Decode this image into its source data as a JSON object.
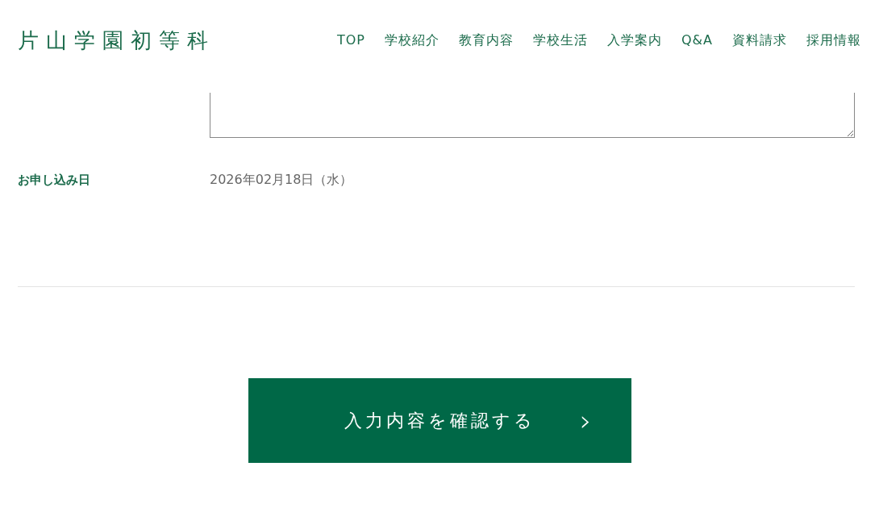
{
  "header": {
    "logo": "片山学園初等科",
    "nav": [
      "TOP",
      "学校紹介",
      "教育内容",
      "学校生活",
      "入学案内",
      "Q&A",
      "資料請求",
      "採用情報"
    ]
  },
  "form": {
    "rows": [
      {
        "label": "お申し込み日",
        "value": "2026年02月18日（水）"
      }
    ]
  },
  "submit": {
    "label": "入力内容を確認する",
    "arrow": "›"
  }
}
